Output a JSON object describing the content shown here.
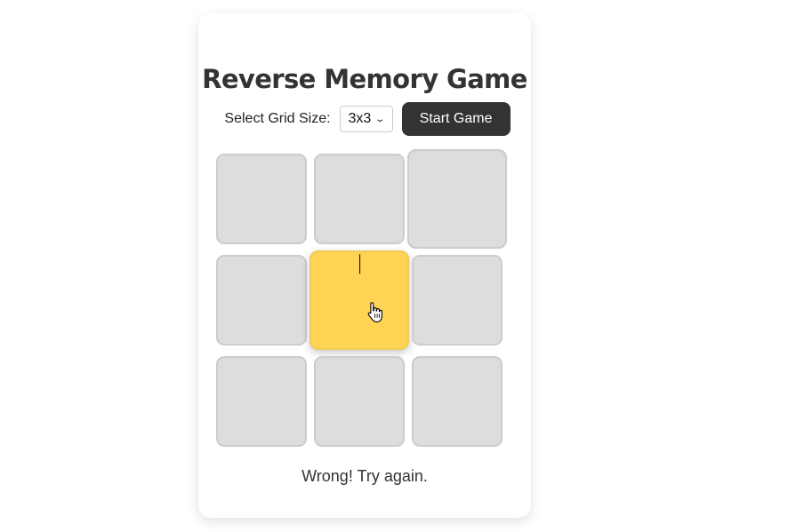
{
  "title": "Reverse Memory Game",
  "controls": {
    "grid_size_label": "Select Grid Size:",
    "grid_size_value": "3x3",
    "start_button_label": "Start Game"
  },
  "grid": {
    "rows": 3,
    "cols": 3,
    "tiles": [
      {
        "index": 0,
        "state": "idle"
      },
      {
        "index": 1,
        "state": "idle"
      },
      {
        "index": 2,
        "state": "hover"
      },
      {
        "index": 3,
        "state": "idle"
      },
      {
        "index": 4,
        "state": "highlighted"
      },
      {
        "index": 5,
        "state": "idle"
      },
      {
        "index": 6,
        "state": "idle"
      },
      {
        "index": 7,
        "state": "idle"
      },
      {
        "index": 8,
        "state": "idle"
      }
    ]
  },
  "colors": {
    "tile": "#dddddd",
    "highlight": "#ffd454",
    "button": "#333333"
  },
  "status_message": "Wrong! Try again."
}
